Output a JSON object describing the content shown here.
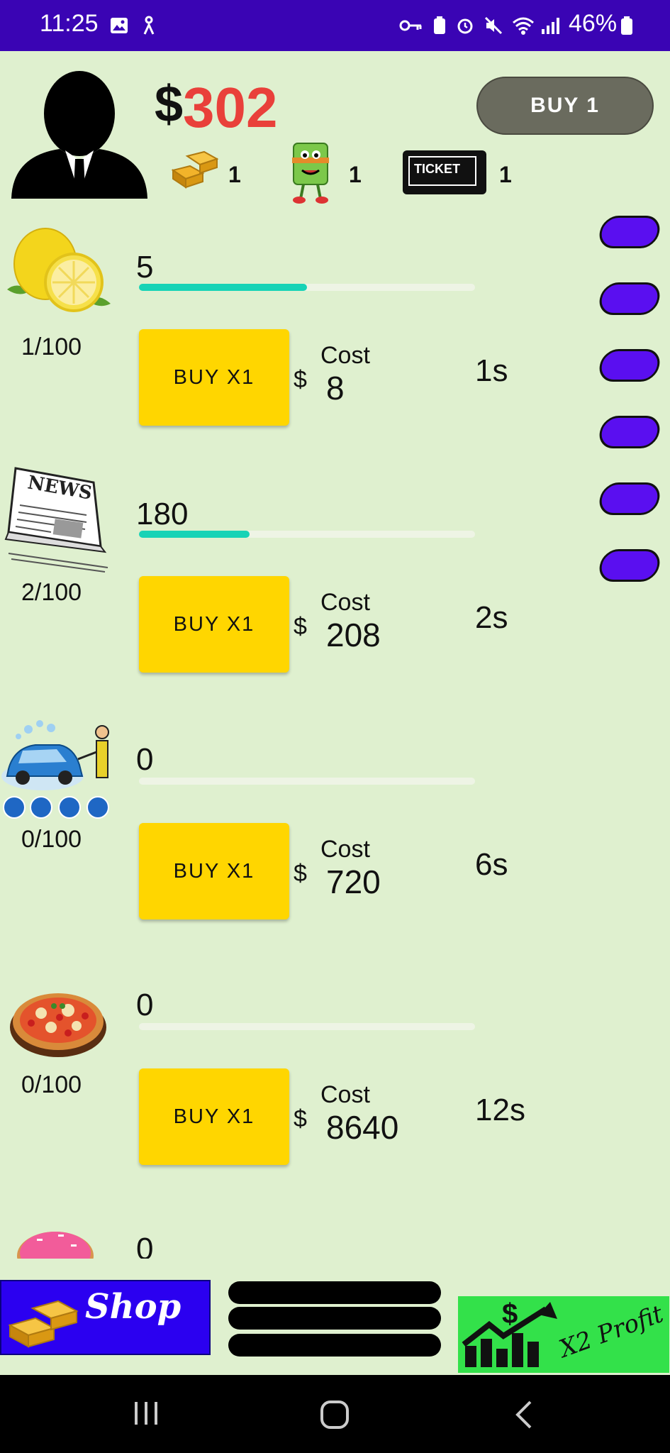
{
  "status_bar": {
    "time": "11:25",
    "battery": "46%"
  },
  "header": {
    "money_symbol": "$",
    "money": "302",
    "gold_count": "1",
    "mascot_count": "1",
    "ticket_count": "1",
    "ticket_text": "TICKET",
    "buy_mode_label": "BUY 1"
  },
  "businesses": [
    {
      "name": "lemon",
      "quantity": "5",
      "level": "1/100",
      "buy_label": "BUY X1",
      "cost_label": "Cost",
      "cost_symbol": "$",
      "cost": "8",
      "time": "1s",
      "progress": 0.5
    },
    {
      "name": "newspaper",
      "quantity": "180",
      "level": "2/100",
      "buy_label": "BUY X1",
      "cost_label": "Cost",
      "cost_symbol": "$",
      "cost": "208",
      "time": "2s",
      "progress": 0.33,
      "image_text": "NEWS"
    },
    {
      "name": "car-wash",
      "quantity": "0",
      "level": "0/100",
      "buy_label": "BUY X1",
      "cost_label": "Cost",
      "cost_symbol": "$",
      "cost": "720",
      "time": "6s",
      "progress": 0
    },
    {
      "name": "pizza",
      "quantity": "0",
      "level": "0/100",
      "buy_label": "BUY X1",
      "cost_label": "Cost",
      "cost_symbol": "$",
      "cost": "8640",
      "time": "12s",
      "progress": 0
    },
    {
      "name": "donut",
      "quantity": "0"
    }
  ],
  "bottom": {
    "shop_label": "Shop",
    "x2_label": "X2 Profit",
    "x2_symbol": "$"
  },
  "colors": {
    "accent_purple": "#5a0ff0",
    "buy_yellow": "#ffd600",
    "progress_teal": "#17d3b6",
    "money_red": "#e9403a"
  }
}
